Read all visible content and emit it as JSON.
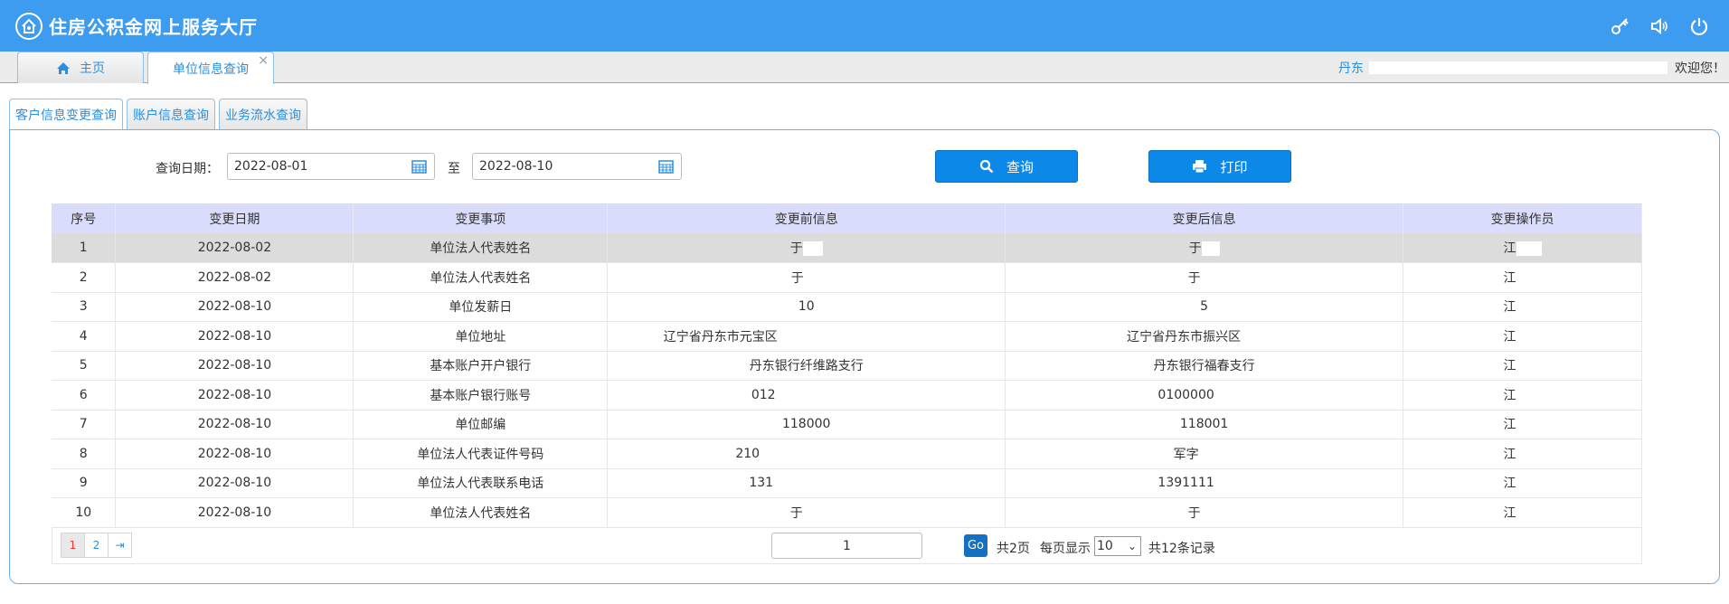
{
  "app": {
    "title": "住房公积金网上服务大厅"
  },
  "top_icons": [
    "key-icon",
    "speaker-icon",
    "power-icon"
  ],
  "tabs": [
    {
      "label": "主页",
      "icon": "home-icon"
    },
    {
      "label": "单位信息查询",
      "close": "×"
    }
  ],
  "user": {
    "city": "丹东",
    "welcome": "欢迎您！"
  },
  "subtabs": [
    "客户信息变更查询",
    "账户信息查询",
    "业务流水查询"
  ],
  "query": {
    "date_label": "查询日期：",
    "start_date": "2022-08-01",
    "to_label": "至",
    "end_date": "2022-08-10",
    "query_button": "查询",
    "print_button": "打印"
  },
  "table": {
    "headers": [
      "序号",
      "变更日期",
      "变更事项",
      "变更前信息",
      "变更后信息",
      "变更操作员"
    ],
    "rows": [
      {
        "no": "1",
        "date": "2022-08-02",
        "item": "单位法人代表姓名",
        "before": "于",
        "after": "于",
        "operator": "江"
      },
      {
        "no": "2",
        "date": "2022-08-02",
        "item": "单位法人代表姓名",
        "before": "于",
        "after": "于",
        "operator": "江"
      },
      {
        "no": "3",
        "date": "2022-08-10",
        "item": "单位发薪日",
        "before": "10",
        "after": "5",
        "operator": "江"
      },
      {
        "no": "4",
        "date": "2022-08-10",
        "item": "单位地址",
        "before": "辽宁省丹东市元宝区",
        "after": "辽宁省丹东市振兴区",
        "operator": "江"
      },
      {
        "no": "5",
        "date": "2022-08-10",
        "item": "基本账户开户银行",
        "before": "丹东银行纤维路支行",
        "after": "丹东银行福春支行",
        "operator": "江"
      },
      {
        "no": "6",
        "date": "2022-08-10",
        "item": "基本账户银行账号",
        "before": "012",
        "after": "0100000",
        "operator": "江"
      },
      {
        "no": "7",
        "date": "2022-08-10",
        "item": "单位邮编",
        "before": "118000",
        "after": "118001",
        "operator": "江"
      },
      {
        "no": "8",
        "date": "2022-08-10",
        "item": "单位法人代表证件号码",
        "before": "210",
        "after": "军字",
        "operator": "江"
      },
      {
        "no": "9",
        "date": "2022-08-10",
        "item": "单位法人代表联系电话",
        "before": "131",
        "after": "1391111",
        "operator": "江"
      },
      {
        "no": "10",
        "date": "2022-08-10",
        "item": "单位法人代表姓名",
        "before": "于",
        "after": "于",
        "operator": "江"
      }
    ]
  },
  "pagination": {
    "pages": [
      "1",
      "2"
    ],
    "last": "⇥",
    "current_page_input": "1",
    "go": "Go",
    "total_pages": "共2页",
    "per_page_label": "每页显示",
    "per_page_value": "10",
    "total_records": "共12条记录"
  }
}
